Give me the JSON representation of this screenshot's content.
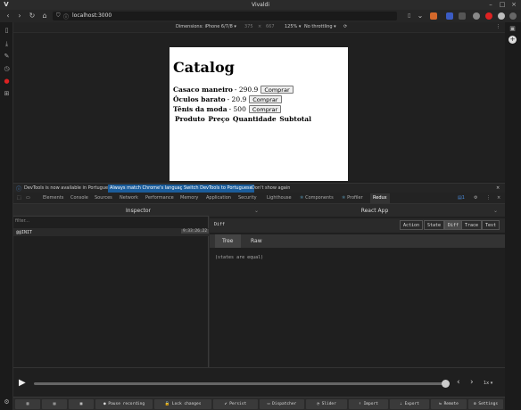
{
  "window": {
    "title": "Vivaldi"
  },
  "address": {
    "url": "localhost:3000"
  },
  "device_toolbar": {
    "dimensions": "Dimensions: iPhone 6/7/8",
    "width": "375",
    "height": "667",
    "zoom": "125%",
    "throttling": "No throttling"
  },
  "page": {
    "title": "Catalog",
    "products": [
      {
        "name": "Casaco maneiro",
        "price": "- 290.9",
        "button": "Comprar"
      },
      {
        "name": "Óculos barato",
        "price": "- 20.9",
        "button": "Comprar"
      },
      {
        "name": "Tênis da moda",
        "price": "- 500",
        "button": "Comprar"
      }
    ],
    "cart_headers": "Produto Preço Quantidade Subtotal"
  },
  "infobar": {
    "message": "DevTools is now available in Portuguese!",
    "match_button": "Always match Chrome's language",
    "switch_button": "Switch DevTools to Portuguese",
    "dismiss": "Don't show again"
  },
  "devtools_tabs": [
    "Elements",
    "Console",
    "Sources",
    "Network",
    "Performance",
    "Memory",
    "Application",
    "Security",
    "Lighthouse",
    "Components",
    "Profiler",
    "Redux"
  ],
  "devtools_badge": "1",
  "redux": {
    "inspector_label": "Inspector",
    "app_label": "React App",
    "filter_placeholder": "filter...",
    "action": {
      "name": "@@INIT",
      "time": "9:33:26.22"
    },
    "diff_label": "Diff",
    "mode_buttons": [
      "Action",
      "State",
      "Diff",
      "Trace",
      "Test"
    ],
    "subtabs": [
      "Tree",
      "Raw"
    ],
    "diff_message": "(states are equal)",
    "speed": "1x",
    "bottom_buttons": [
      "Pause recording",
      "Lock changes",
      "Persist",
      "Dispatcher",
      "Slider",
      "Import",
      "Export",
      "Remote",
      "Settings"
    ]
  },
  "colors": {
    "accent": "#1b5d9b",
    "page_bg": "#ffffff",
    "panel_bg": "#1f1f1f"
  }
}
